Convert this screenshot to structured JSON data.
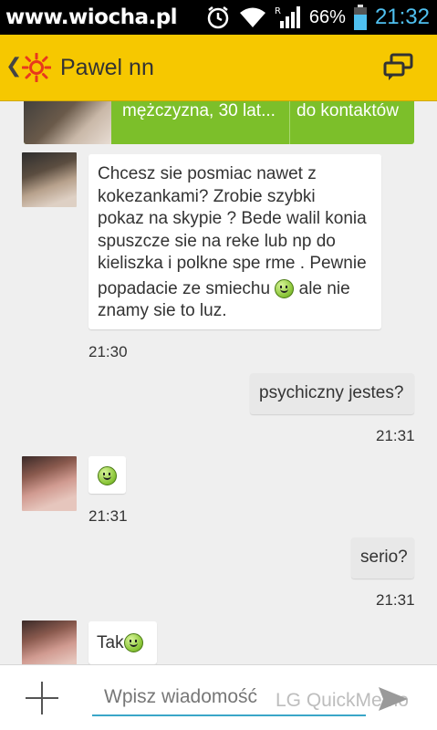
{
  "status_bar": {
    "watermark": "www.wiocha.pl",
    "battery_percent": "66%",
    "clock": "21:32"
  },
  "header": {
    "contact_name": "Pawel nn"
  },
  "profile_card": {
    "info": "mężczyzna, 30 lat...",
    "add_contact_label": "do kontaktów"
  },
  "messages": [
    {
      "direction": "in",
      "lines": [
        "Chcesz sie posmiac nawet z",
        "kokezankami? Zrobie szybki",
        "pokaz na skypie ? Bede walil konia",
        "spuszcze sie na reke lub np do",
        "kieliszka i polkne spe rme . Pewnie",
        "popadacie ze smiechu",
        "ale nie",
        "znamy sie to luz."
      ],
      "time": "21:30"
    },
    {
      "direction": "out",
      "text": "psychiczny jestes?",
      "time": "21:31"
    },
    {
      "direction": "in",
      "emoji": "smiley",
      "time": "21:31"
    },
    {
      "direction": "out",
      "text": "serio?",
      "time": "21:31"
    },
    {
      "direction": "in",
      "text": "Tak",
      "emoji": "smiley"
    }
  ],
  "composer": {
    "placeholder": "Wpisz wiadomość",
    "overlay_watermark": "LG QuickMemo"
  },
  "colors": {
    "header_bg": "#f6c800",
    "profile_card_bg": "#7cbf2a",
    "clock": "#4fc0f0",
    "input_underline": "#3aa6c8"
  }
}
